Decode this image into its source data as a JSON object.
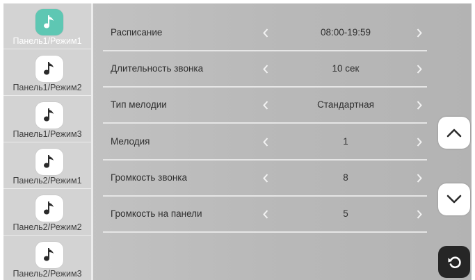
{
  "sidebar": {
    "items": [
      {
        "label": "Панель1/Режим1",
        "icon": "music-note-icon",
        "active": true
      },
      {
        "label": "Панель1/Режим2",
        "icon": "music-note-icon",
        "active": false
      },
      {
        "label": "Панель1/Режим3",
        "icon": "music-note-icon",
        "active": false
      },
      {
        "label": "Панель2/Режим1",
        "icon": "music-note-icon",
        "active": false
      },
      {
        "label": "Панель2/Режим2",
        "icon": "music-note-icon",
        "active": false
      },
      {
        "label": "Панель2/Режим3",
        "icon": "music-note-icon",
        "active": false
      }
    ]
  },
  "settings": [
    {
      "label": "Расписание",
      "value": "08:00-19:59"
    },
    {
      "label": "Длительность звонка",
      "value": "10 сек"
    },
    {
      "label": "Тип мелодии",
      "value": "Стандартная"
    },
    {
      "label": "Мелодия",
      "value": "1"
    },
    {
      "label": "Громкость звонка",
      "value": "8"
    },
    {
      "label": "Громкость на панели",
      "value": "5"
    }
  ],
  "controls": {
    "scroll_up_icon": "chevron-up-icon",
    "scroll_down_icon": "chevron-down-icon",
    "back_icon": "return-arrow-icon"
  },
  "colors": {
    "accent": "#5ec7b3",
    "panel_bg": "#bfbfbf",
    "sidebar_bg": "#d3d3d3",
    "back_button": "#262626"
  }
}
